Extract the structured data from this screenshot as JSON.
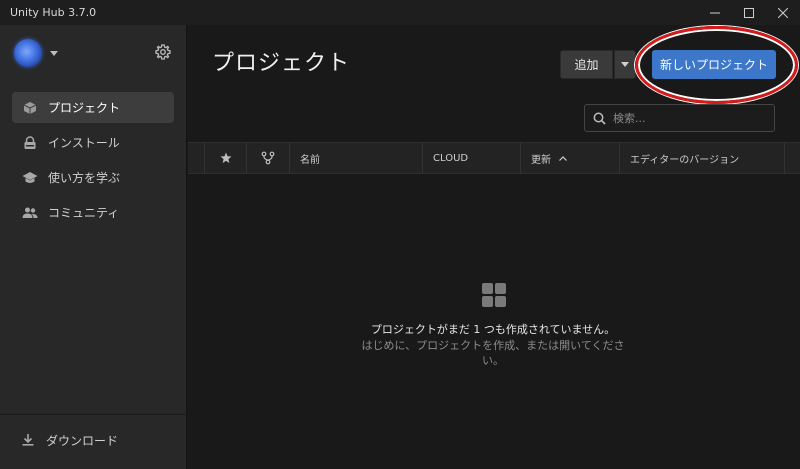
{
  "window": {
    "title": "Unity Hub 3.7.0"
  },
  "sidebar": {
    "items": [
      {
        "label": "プロジェクト",
        "icon": "cube-icon",
        "active": true
      },
      {
        "label": "インストール",
        "icon": "lock-icon",
        "active": false
      },
      {
        "label": "使い方を学ぶ",
        "icon": "graduation-cap-icon",
        "active": false
      },
      {
        "label": "コミュニティ",
        "icon": "people-icon",
        "active": false
      }
    ],
    "download_label": "ダウンロード"
  },
  "main": {
    "title": "プロジェクト",
    "add_button": "追加",
    "new_project_button": "新しいプロジェクト",
    "search_placeholder": "検索...",
    "columns": {
      "name": "名前",
      "cloud": "CLOUD",
      "updated": "更新",
      "editor_version": "エディターのバージョン"
    },
    "empty_title": "プロジェクトがまだ 1 つも作成されていません。",
    "empty_subtitle": "はじめに、プロジェクトを作成、または開いてください。"
  },
  "colors": {
    "accent": "#3d77c9",
    "highlight_ring": "#d61b1b"
  }
}
